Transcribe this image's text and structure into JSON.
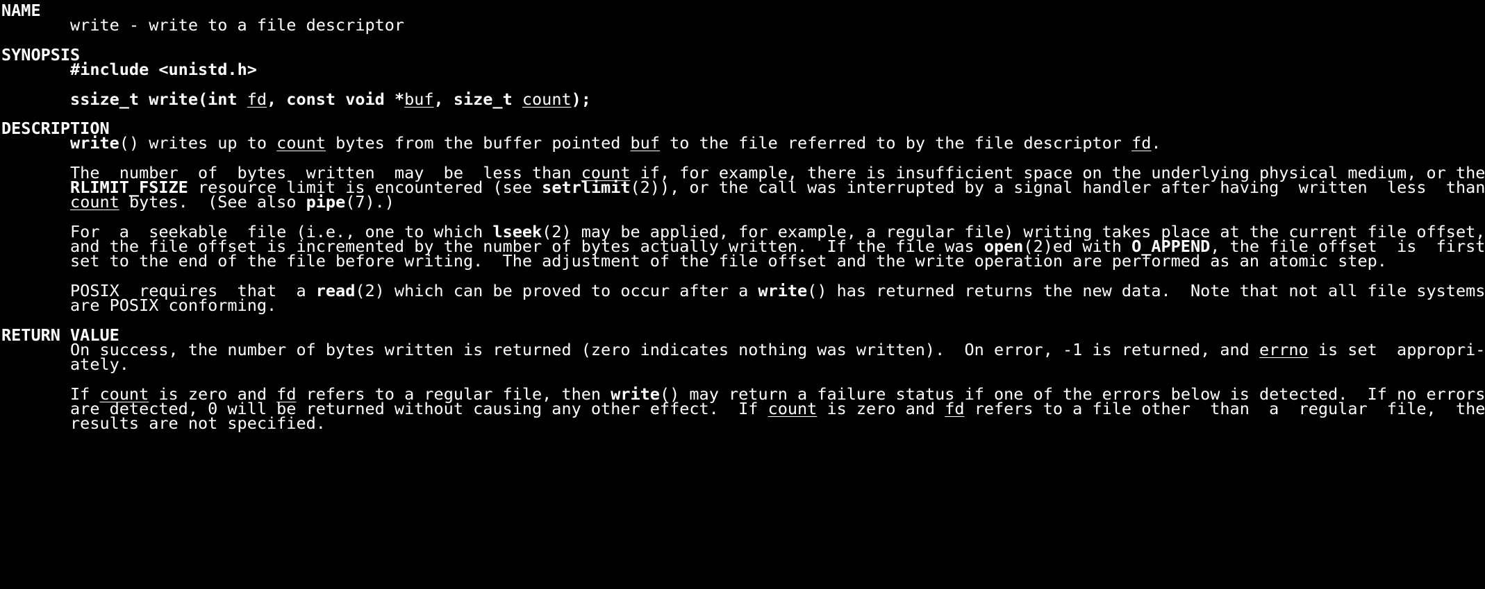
{
  "man_page": {
    "lines": [
      [
        {
          "t": "NAME",
          "s": "b"
        }
      ],
      [
        {
          "t": "       write - write to a file descriptor"
        }
      ],
      [],
      [
        {
          "t": "SYNOPSIS",
          "s": "b"
        }
      ],
      [
        {
          "t": "       "
        },
        {
          "t": "#include <unistd.h>",
          "s": "b"
        }
      ],
      [],
      [
        {
          "t": "       "
        },
        {
          "t": "ssize_t write(int ",
          "s": "b"
        },
        {
          "t": "fd",
          "s": "u"
        },
        {
          "t": ", const void *",
          "s": "b"
        },
        {
          "t": "buf",
          "s": "u"
        },
        {
          "t": ", size_t ",
          "s": "b"
        },
        {
          "t": "count",
          "s": "u"
        },
        {
          "t": ");",
          "s": "b"
        }
      ],
      [],
      [
        {
          "t": "DESCRIPTION",
          "s": "b"
        }
      ],
      [
        {
          "t": "       "
        },
        {
          "t": "write",
          "s": "b"
        },
        {
          "t": "() writes up to "
        },
        {
          "t": "count",
          "s": "u"
        },
        {
          "t": " bytes from the buffer pointed "
        },
        {
          "t": "buf",
          "s": "u"
        },
        {
          "t": " to the file referred to by the file descriptor "
        },
        {
          "t": "fd",
          "s": "u"
        },
        {
          "t": "."
        }
      ],
      [],
      [
        {
          "t": "       The  number  of  bytes  written  may  be  less than "
        },
        {
          "t": "count",
          "s": "u"
        },
        {
          "t": " if, for example, there is insufficient space on the underlying physical medium, or the"
        }
      ],
      [
        {
          "t": "       "
        },
        {
          "t": "RLIMIT_FSIZE",
          "s": "b"
        },
        {
          "t": " resource limit is encountered (see "
        },
        {
          "t": "setrlimit",
          "s": "b"
        },
        {
          "t": "(2)), or the call was interrupted by a signal handler after having  written  less  than"
        }
      ],
      [
        {
          "t": "       "
        },
        {
          "t": "count",
          "s": "u"
        },
        {
          "t": " bytes.  (See also "
        },
        {
          "t": "pipe",
          "s": "b"
        },
        {
          "t": "(7).)"
        }
      ],
      [],
      [
        {
          "t": "       For  a  seekable  file (i.e., one to which "
        },
        {
          "t": "lseek",
          "s": "b"
        },
        {
          "t": "(2) may be applied, for example, a regular file) writing takes place at the current file offset,"
        }
      ],
      [
        {
          "t": "       and the file offset is incremented by the number of bytes actually written.  If the file was "
        },
        {
          "t": "open",
          "s": "b"
        },
        {
          "t": "(2)ed with "
        },
        {
          "t": "O_APPEND",
          "s": "b"
        },
        {
          "t": ", the file offset  is  first"
        }
      ],
      [
        {
          "t": "       set to the end of the file before writing.  The adjustment of the file offset and the write operation are performed as an atomic step."
        }
      ],
      [],
      [
        {
          "t": "       POSIX  requires  that  a "
        },
        {
          "t": "read",
          "s": "b"
        },
        {
          "t": "(2) which can be proved to occur after a "
        },
        {
          "t": "write",
          "s": "b"
        },
        {
          "t": "() has returned returns the new data.  Note that not all file systems"
        }
      ],
      [
        {
          "t": "       are POSIX conforming."
        }
      ],
      [],
      [
        {
          "t": "RETURN VALUE",
          "s": "b"
        }
      ],
      [
        {
          "t": "       On success, the number of bytes written is returned (zero indicates nothing was written).  On error, -1 is returned, and "
        },
        {
          "t": "errno",
          "s": "u"
        },
        {
          "t": " is set  appropri-"
        }
      ],
      [
        {
          "t": "       ately."
        }
      ],
      [],
      [
        {
          "t": "       If "
        },
        {
          "t": "count",
          "s": "u"
        },
        {
          "t": " is zero and "
        },
        {
          "t": "fd",
          "s": "u"
        },
        {
          "t": " refers to a regular file, then "
        },
        {
          "t": "write",
          "s": "b"
        },
        {
          "t": "() may return a failure status if one of the errors below is detected.  If no errors"
        }
      ],
      [
        {
          "t": "       are detected, 0 will be returned without causing any other effect.  If "
        },
        {
          "t": "count",
          "s": "u"
        },
        {
          "t": " is zero and "
        },
        {
          "t": "fd",
          "s": "u"
        },
        {
          "t": " refers to a file other  than  a  regular  file,  the"
        }
      ],
      [
        {
          "t": "       results are not specified."
        }
      ]
    ]
  }
}
